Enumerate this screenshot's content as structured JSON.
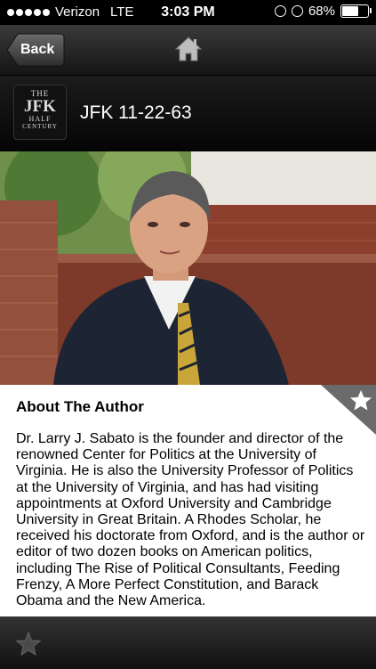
{
  "status_bar": {
    "carrier": "Verizon",
    "network": "LTE",
    "time": "3:03 PM",
    "battery": "68%",
    "battery_level": 0.68
  },
  "nav": {
    "back_label": "Back",
    "home_icon": "home-icon"
  },
  "header": {
    "logo_line1": "THE",
    "logo_line2": "JFK",
    "logo_line3": "HALF",
    "logo_line4": "CENTURY",
    "title": "JFK 11-22-63"
  },
  "content": {
    "section_title": "About The Author",
    "bio": "Dr. Larry J. Sabato is the founder and director of the renowned Center for Politics at the University of Virginia. He is also the University Professor of Politics at the University of Virginia, and has had visiting appointments at Oxford University and Cambridge University in Great Britain. A Rhodes Scholar, he received his doctorate from Oxford, and is the author or editor of two dozen books on American politics, including The Rise of Political Consultants, Feeding Frenzy, A More Perfect Constitution, and Barack Obama and the New America.",
    "corner_icon": "star-icon"
  },
  "bottom_bar": {
    "icon": "star-icon"
  },
  "colors": {
    "accent_gray": "#4a4a4a",
    "content_bg": "#ffffff"
  }
}
